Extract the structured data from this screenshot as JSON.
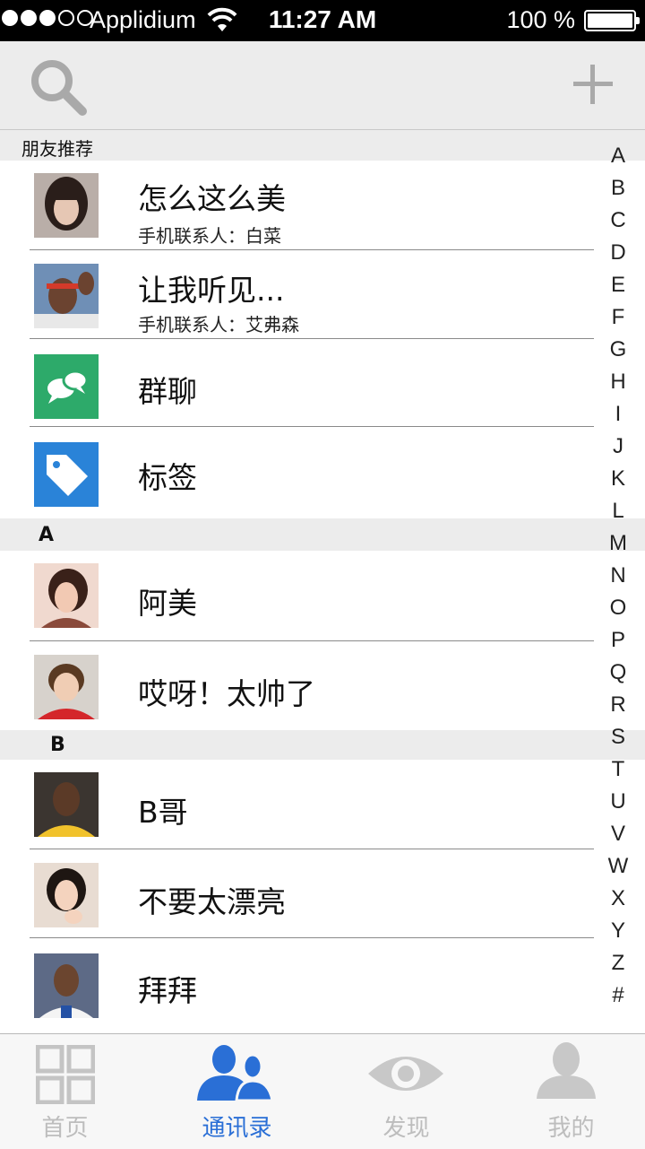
{
  "status_bar": {
    "carrier": "Applidium",
    "time": "11:27 AM",
    "battery": "100 %"
  },
  "navbar": {
    "left_icon": "search-icon",
    "right_icon": "plus-icon"
  },
  "sections": [
    {
      "title": "朋友推荐",
      "rows": [
        {
          "name": "怎么这么美",
          "sub": "手机联系人：白菜",
          "avatar": "photo"
        },
        {
          "name": "让我听见...",
          "sub": "手机联系人：艾弗森",
          "avatar": "photo"
        },
        {
          "name": "群聊",
          "avatar": "group-chat-icon"
        },
        {
          "name": "标签",
          "avatar": "tag-icon"
        }
      ]
    },
    {
      "title": "A",
      "rows": [
        {
          "name": "阿美",
          "avatar": "photo"
        },
        {
          "name": "哎呀！太帅了",
          "avatar": "photo"
        }
      ]
    },
    {
      "title": "B",
      "rows": [
        {
          "name": "B哥",
          "avatar": "photo"
        },
        {
          "name": "不要太漂亮",
          "avatar": "photo"
        },
        {
          "name": "拜拜",
          "avatar": "photo"
        }
      ]
    }
  ],
  "index_letters": [
    "A",
    "B",
    "C",
    "D",
    "E",
    "F",
    "G",
    "H",
    "I",
    "J",
    "K",
    "L",
    "M",
    "N",
    "O",
    "P",
    "Q",
    "R",
    "S",
    "T",
    "U",
    "V",
    "W",
    "X",
    "Y",
    "Z",
    "#"
  ],
  "tabs": [
    {
      "label": "首页",
      "icon": "grid-icon",
      "active": false
    },
    {
      "label": "通讯录",
      "icon": "contacts-icon",
      "active": true
    },
    {
      "label": "发现",
      "icon": "eye-icon",
      "active": false
    },
    {
      "label": "我的",
      "icon": "user-icon",
      "active": false
    }
  ],
  "colors": {
    "accent": "#2a6fd6",
    "group_chat_bg": "#2daa6a",
    "tag_bg": "#2a83d8",
    "inactive_tab": "#bdbdbd",
    "section_bg": "#ececec"
  }
}
